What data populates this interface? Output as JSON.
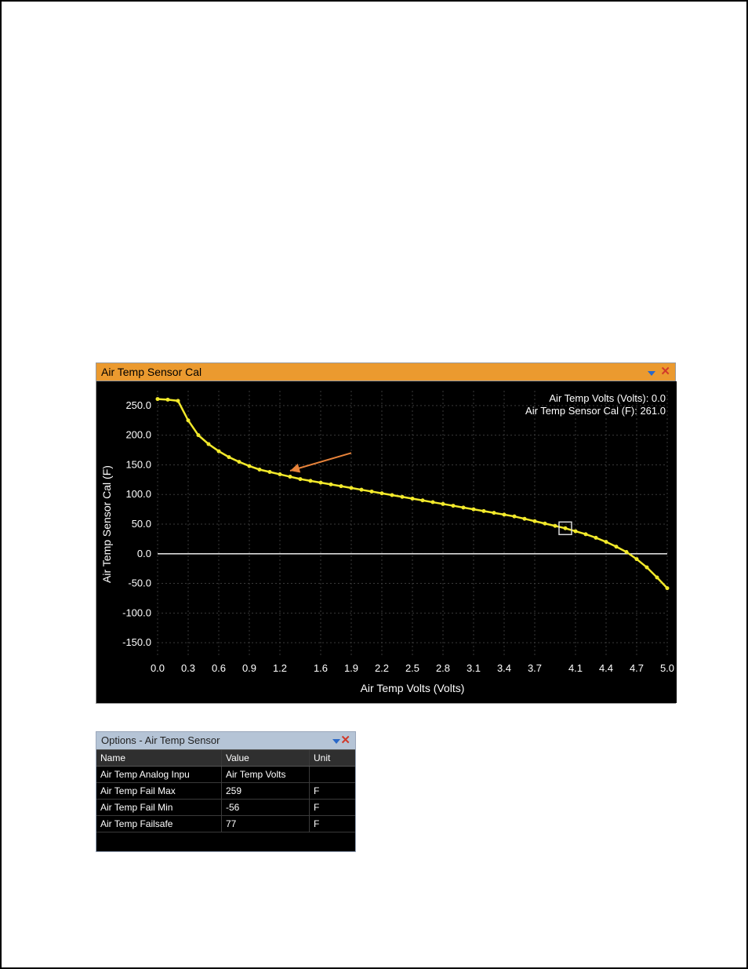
{
  "chart": {
    "title": "Air Temp Sensor Cal",
    "readout1": "Air Temp Volts (Volts): 0.0",
    "readout2": "Air Temp Sensor Cal (F): 261.0",
    "ylabel": "Air Temp Sensor Cal (F)",
    "xlabel": "Air Temp Volts (Volts)",
    "yticks": [
      "250.0",
      "200.0",
      "150.0",
      "100.0",
      "50.0",
      "0.0",
      "-50.0",
      "-100.0",
      "-150.0"
    ],
    "xticks": [
      "0.0",
      "0.3",
      "0.6",
      "0.9",
      "1.2",
      "1.6",
      "1.9",
      "2.2",
      "2.5",
      "2.8",
      "3.1",
      "3.4",
      "3.7",
      "4.1",
      "4.4",
      "4.7",
      "5.0"
    ]
  },
  "chart_data": {
    "type": "line",
    "title": "Air Temp Sensor Cal",
    "xlabel": "Air Temp Volts (Volts)",
    "ylabel": "Air Temp Sensor Cal (F)",
    "xlim": [
      0.0,
      5.0
    ],
    "ylim": [
      -175.0,
      275.0
    ],
    "series": [
      {
        "name": "Air Temp Sensor Cal",
        "color": "#f2e92b",
        "x": [
          0.0,
          0.1,
          0.2,
          0.3,
          0.4,
          0.5,
          0.6,
          0.7,
          0.8,
          0.9,
          1.0,
          1.1,
          1.2,
          1.3,
          1.4,
          1.5,
          1.6,
          1.7,
          1.8,
          1.9,
          2.0,
          2.1,
          2.2,
          2.3,
          2.4,
          2.5,
          2.6,
          2.7,
          2.8,
          2.9,
          3.0,
          3.1,
          3.2,
          3.3,
          3.4,
          3.5,
          3.6,
          3.7,
          3.8,
          3.9,
          4.0,
          4.1,
          4.2,
          4.3,
          4.4,
          4.5,
          4.6,
          4.7,
          4.8,
          4.9,
          5.0
        ],
        "y": [
          261,
          260,
          258,
          225,
          200,
          185,
          173,
          163,
          155,
          148,
          142,
          138,
          134,
          130,
          126,
          123,
          120,
          117,
          114,
          111,
          108,
          105,
          102,
          99,
          96,
          93,
          90,
          87,
          84,
          81,
          78,
          75,
          72,
          69,
          66,
          63,
          59,
          55,
          51,
          47,
          43,
          38,
          33,
          27,
          20,
          12,
          3,
          -9,
          -23,
          -40,
          -58
        ]
      }
    ],
    "cursor": {
      "x": 4.0,
      "y": 43
    },
    "arrow": {
      "from": [
        1.9,
        170
      ],
      "to": [
        1.3,
        140
      ]
    }
  },
  "options": {
    "title": "Options - Air Temp Sensor",
    "headers": {
      "name": "Name",
      "value": "Value",
      "unit": "Unit"
    },
    "rows": [
      {
        "name": "Air Temp Analog Inpu",
        "value": "Air Temp Volts",
        "unit": ""
      },
      {
        "name": "Air Temp Fail Max",
        "value": "259",
        "unit": "F"
      },
      {
        "name": "Air Temp Fail Min",
        "value": "-56",
        "unit": "F"
      },
      {
        "name": "Air Temp Failsafe",
        "value": "77",
        "unit": "F"
      }
    ]
  }
}
